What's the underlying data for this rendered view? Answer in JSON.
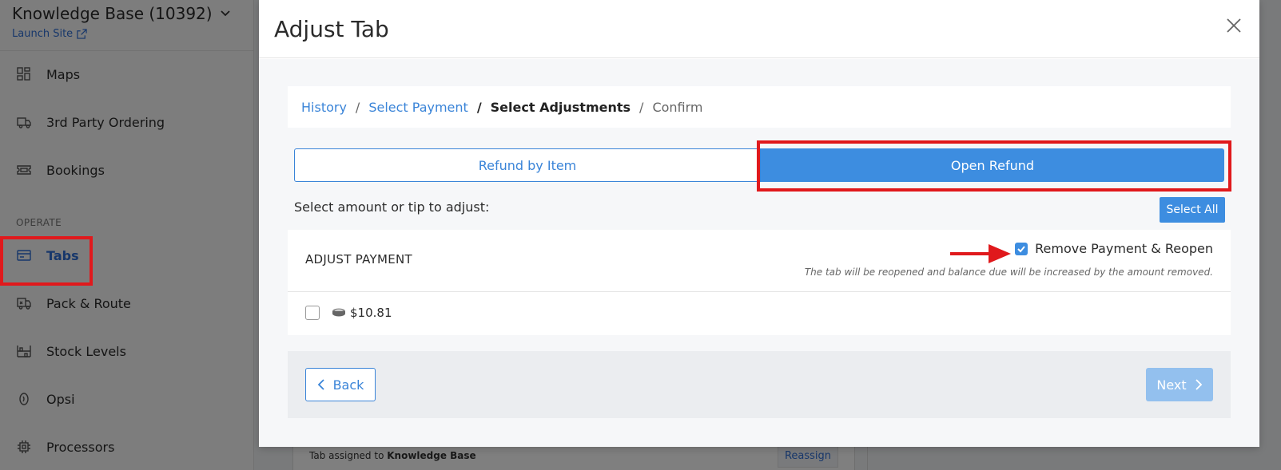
{
  "sidebar": {
    "site_name": "Knowledge Base (10392)",
    "launch_site": "Launch Site",
    "section_label": "OPERATE",
    "items": [
      {
        "label": "Maps",
        "icon": "grid-icon"
      },
      {
        "label": "3rd Party Ordering",
        "icon": "delivery-truck-icon"
      },
      {
        "label": "Bookings",
        "icon": "ticket-icon"
      },
      {
        "label": "Tabs",
        "icon": "card-icon"
      },
      {
        "label": "Pack & Route",
        "icon": "pack-route-icon"
      },
      {
        "label": "Stock Levels",
        "icon": "shelves-icon"
      },
      {
        "label": "Opsi",
        "icon": "opsi-icon"
      },
      {
        "label": "Processors",
        "icon": "chip-icon"
      }
    ]
  },
  "background": {
    "tab_assigned_prefix": "Tab assigned to",
    "tab_assigned_name": "Knowledge Base",
    "reassign": "Reassign"
  },
  "modal": {
    "title": "Adjust Tab",
    "breadcrumb": {
      "history": "History",
      "select_payment": "Select Payment",
      "select_adjustments": "Select Adjustments",
      "confirm": "Confirm",
      "separator": "/"
    },
    "tabs": {
      "refund_by_item": "Refund by Item",
      "open_refund": "Open Refund"
    },
    "select_label": "Select amount or tip to adjust:",
    "select_all": "Select All",
    "adjust": {
      "title": "ADJUST PAYMENT",
      "remove_label": "Remove Payment & Reopen",
      "remove_checked": true,
      "note": "The tab will be reopened and balance due will be increased by the amount removed.",
      "payment_amount": "$10.81",
      "payment_checked": false
    },
    "footer": {
      "back": "Back",
      "next": "Next"
    }
  },
  "colors": {
    "accent": "#3d8de0",
    "annotation_red": "#e0191c",
    "next_disabled": "#93c0ee"
  }
}
